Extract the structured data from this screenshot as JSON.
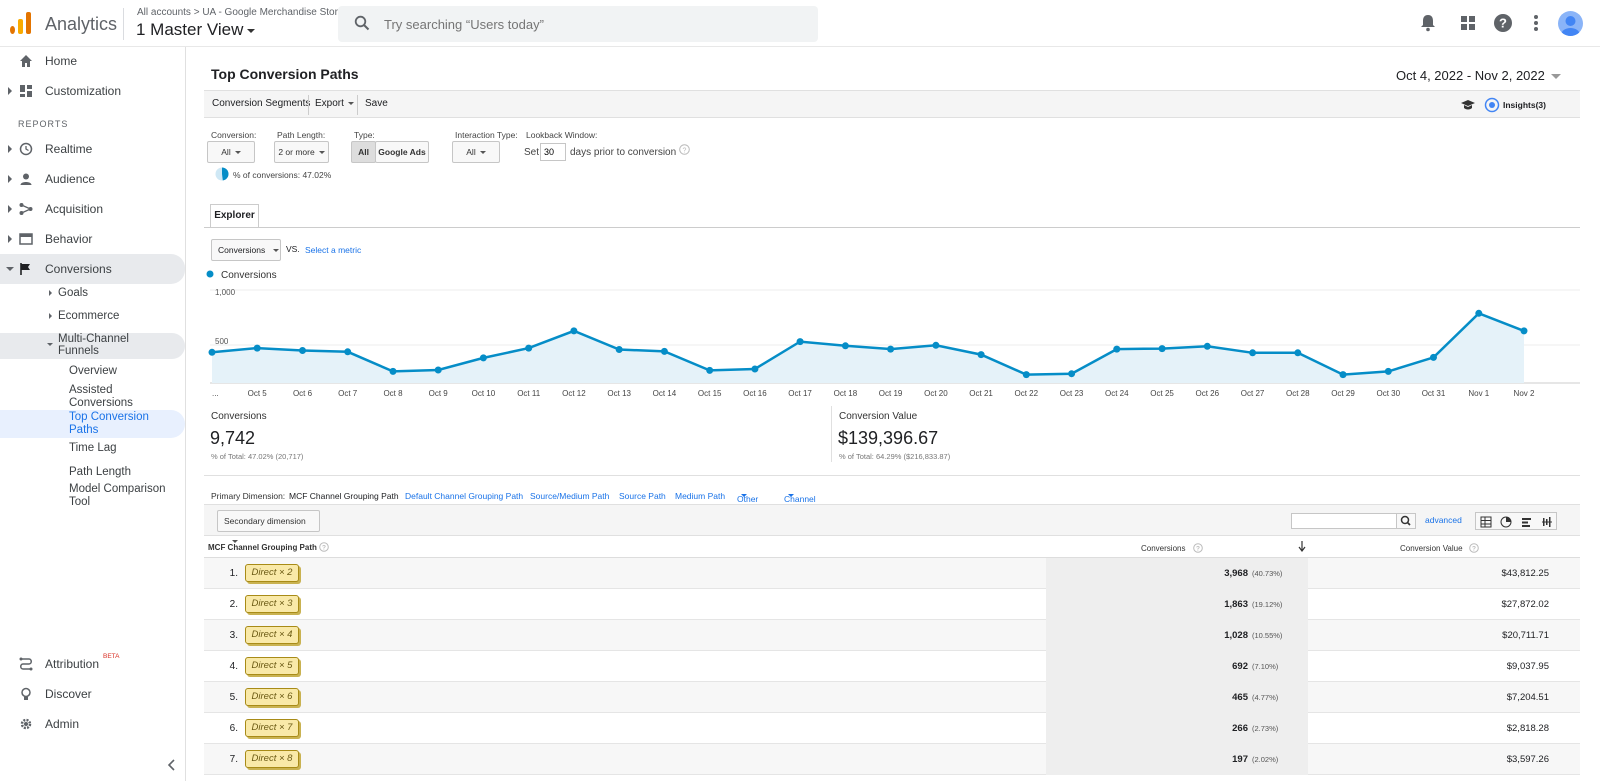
{
  "header": {
    "app_name": "Analytics",
    "breadcrumb_root": "All accounts",
    "breadcrumb_sep": ">",
    "breadcrumb_property": "UA - Google Merchandise Store",
    "view_name": "1 Master View",
    "search_placeholder": "Try searching “Users today”"
  },
  "sidebar": {
    "items": [
      {
        "label": "Home",
        "icon": "home-icon"
      },
      {
        "label": "Customization",
        "icon": "dashboard-icon"
      },
      {
        "label": "Realtime",
        "icon": "clock-icon"
      },
      {
        "label": "Audience",
        "icon": "person-icon"
      },
      {
        "label": "Acquisition",
        "icon": "acquisition-icon"
      },
      {
        "label": "Behavior",
        "icon": "behavior-icon"
      },
      {
        "label": "Conversions",
        "icon": "flag-icon"
      }
    ],
    "section_label": "REPORTS",
    "conversion_children": [
      "Goals",
      "Ecommerce",
      "Multi-Channel Funnels"
    ],
    "mcf_children": [
      "Overview",
      "Assisted Conversions",
      "Top Conversion Paths",
      "Time Lag",
      "Path Length",
      "Model Comparison Tool"
    ],
    "bottom_items": [
      {
        "label": "Attribution",
        "icon": "attribution-icon",
        "badge": "BETA"
      },
      {
        "label": "Discover",
        "icon": "bulb-icon"
      },
      {
        "label": "Admin",
        "icon": "gear-icon"
      }
    ]
  },
  "page": {
    "title": "Top Conversion Paths",
    "date_range": "Oct 4, 2022 - Nov 2, 2022",
    "toolbar": {
      "conversion_segments": "Conversion Segments",
      "export": "Export",
      "save": "Save",
      "insights": "Insights(3)"
    },
    "filters": {
      "conversion_label": "Conversion:",
      "conversion_value": "All",
      "path_length_label": "Path Length:",
      "path_length_value": "2 or more",
      "type_label": "Type:",
      "type_all": "All",
      "type_ads": "Google Ads",
      "interaction_label": "Interaction Type:",
      "interaction_value": "All",
      "lookback_label": "Lookback Window:",
      "lookback_set": "Set",
      "lookback_days": "30",
      "lookback_suffix": "days prior to conversion",
      "pct_conversions": "% of conversions: 47.02%"
    },
    "explorer_tab": "Explorer",
    "metric": "Conversions",
    "vs": "VS.",
    "select_metric": "Select a metric",
    "legend": "Conversions"
  },
  "chart_data": {
    "type": "line",
    "series": [
      {
        "name": "Conversions",
        "values": [
          330,
          375,
          350,
          335,
          125,
          140,
          270,
          375,
          560,
          360,
          340,
          135,
          150,
          445,
          400,
          365,
          405,
          305,
          90,
          100,
          365,
          370,
          395,
          325,
          325,
          90,
          125,
          275,
          750,
          560
        ]
      }
    ],
    "x": [
      "...",
      "Oct 5",
      "Oct 6",
      "Oct 7",
      "Oct 8",
      "Oct 9",
      "Oct 10",
      "Oct 11",
      "Oct 12",
      "Oct 13",
      "Oct 14",
      "Oct 15",
      "Oct 16",
      "Oct 17",
      "Oct 18",
      "Oct 19",
      "Oct 20",
      "Oct 21",
      "Oct 22",
      "Oct 23",
      "Oct 24",
      "Oct 25",
      "Oct 26",
      "Oct 27",
      "Oct 28",
      "Oct 29",
      "Oct 30",
      "Oct 31",
      "Nov 1",
      "Nov 2"
    ],
    "yticks": [
      "1,000",
      "500"
    ],
    "ylim": [
      0,
      1000
    ],
    "color": "#058dc7"
  },
  "scorecards": [
    {
      "label": "Conversions",
      "value": "9,742",
      "sub": "% of Total: 47.02% (20,717)"
    },
    {
      "label": "Conversion Value",
      "value": "$139,396.67",
      "sub": "% of Total: 64.29% ($216,833.87)"
    }
  ],
  "dimensions": {
    "primary_label": "Primary Dimension:",
    "active": "MCF Channel Grouping Path",
    "options": [
      "Default Channel Grouping Path",
      "Source/Medium Path",
      "Source Path",
      "Medium Path",
      "Other",
      "Channel Groupings"
    ],
    "secondary": "Secondary dimension",
    "advanced": "advanced"
  },
  "table": {
    "col_path": "MCF Channel Grouping Path",
    "col_conv": "Conversions",
    "col_value": "Conversion Value",
    "rows": [
      {
        "num": "1.",
        "path": "Direct × 2",
        "conv": "3,968",
        "pct": "(40.73%)",
        "value": "$43,812.25"
      },
      {
        "num": "2.",
        "path": "Direct × 3",
        "conv": "1,863",
        "pct": "(19.12%)",
        "value": "$27,872.02"
      },
      {
        "num": "3.",
        "path": "Direct × 4",
        "conv": "1,028",
        "pct": "(10.55%)",
        "value": "$20,711.71"
      },
      {
        "num": "4.",
        "path": "Direct × 5",
        "conv": "692",
        "pct": "(7.10%)",
        "value": "$9,037.95"
      },
      {
        "num": "5.",
        "path": "Direct × 6",
        "conv": "465",
        "pct": "(4.77%)",
        "value": "$7,204.51"
      },
      {
        "num": "6.",
        "path": "Direct × 7",
        "conv": "266",
        "pct": "(2.73%)",
        "value": "$2,818.28"
      },
      {
        "num": "7.",
        "path": "Direct × 8",
        "conv": "197",
        "pct": "(2.02%)",
        "value": "$3,597.26"
      }
    ]
  },
  "colors": {
    "accent": "#1a73e8",
    "chart_line": "#058dc7",
    "tag_bg": "#f9e9a8"
  }
}
